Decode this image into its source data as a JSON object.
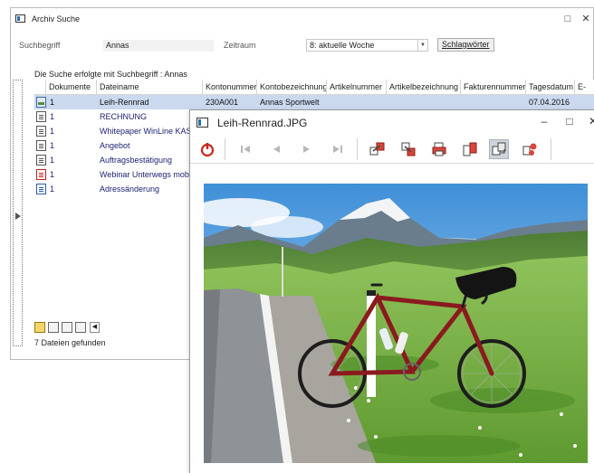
{
  "main_window": {
    "title": "Archiv Suche",
    "minimize": "□",
    "close": "✕"
  },
  "search": {
    "label": "Suchbegriff",
    "value": "Annas",
    "period_label": "Zeitraum",
    "period_value": "8: aktuelle Woche",
    "tags_button": "Schlagwörter",
    "info": "Die Suche erfolgte mit Suchbegriff :  Annas"
  },
  "grid": {
    "columns": [
      "Dokumente",
      "Dateiname",
      "Kontonummer",
      "Kontobezeichnung",
      "Artikelnummer",
      "Artikelbezeichnung",
      "Fakturennummer",
      "Tagesdatum",
      "E-"
    ],
    "rows": [
      {
        "icon": "image-file-icon",
        "docs": "1",
        "name": "Leih-Rennrad",
        "account": "230A001",
        "account_name": "Annas Sportwelt",
        "date": "07.04.2016"
      },
      {
        "icon": "text-file-icon",
        "docs": "1",
        "name": "RECHNUNG",
        "account": "",
        "account_name": "",
        "date": ""
      },
      {
        "icon": "text-file-icon",
        "docs": "1",
        "name": "Whitepaper WinLine KASS",
        "account": "",
        "account_name": "",
        "date": ""
      },
      {
        "icon": "text-file-icon",
        "docs": "1",
        "name": "Angebot",
        "account": "",
        "account_name": "",
        "date": ""
      },
      {
        "icon": "text-file-icon",
        "docs": "1",
        "name": "Auftragsbestätigung",
        "account": "",
        "account_name": "",
        "date": ""
      },
      {
        "icon": "pdf-file-icon",
        "docs": "1",
        "name": "Webinar Unterwegs mobil",
        "account": "",
        "account_name": "",
        "date": ""
      },
      {
        "icon": "word-file-icon",
        "docs": "1",
        "name": "Adressänderung",
        "account": "",
        "account_name": "",
        "date": ""
      }
    ]
  },
  "status": "7 Dateien gefunden",
  "viewer": {
    "title": "Leih-Rennrad.JPG",
    "minimize": "–",
    "maximize": "□",
    "toolbar": [
      "power-icon",
      "first-icon",
      "prev-icon",
      "next-icon",
      "last-icon",
      "export-icon",
      "import-icon",
      "print-icon",
      "copy-icon",
      "convert-icon",
      "share-icon"
    ],
    "colors": {
      "red": "#c8281e",
      "gray": "#9a9a9a",
      "selected_row": "#cbd9ef"
    }
  }
}
